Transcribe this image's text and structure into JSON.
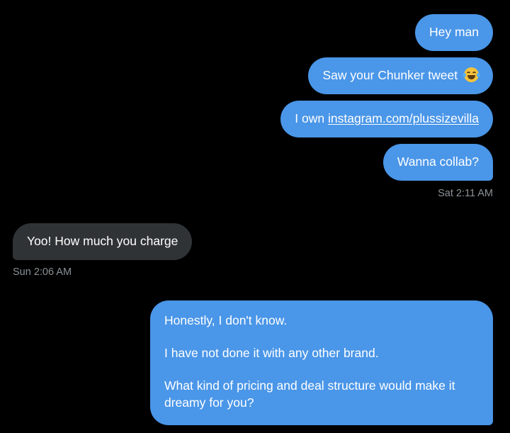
{
  "conversation": {
    "group_sat": {
      "messages": [
        {
          "text": "Hey man"
        },
        {
          "text": "Saw your Chunker tweet",
          "emoji": "face-with-tears-of-joy"
        },
        {
          "prefix": "I own ",
          "link": "instagram.com/plussizevilla"
        },
        {
          "text": "Wanna collab?"
        }
      ],
      "timestamp": "Sat 2:11 AM"
    },
    "group_sun": {
      "messages": [
        {
          "text": "Yoo! How much you charge"
        }
      ],
      "timestamp": "Sun 2:06 AM"
    },
    "group_reply": {
      "paragraphs": [
        "Honestly, I don't know.",
        "I have not done it with any other brand.",
        "What kind of pricing and deal structure would make it dreamy for you?"
      ]
    }
  },
  "colors": {
    "background": "#000000",
    "outgoing_bubble": "#4a96e8",
    "incoming_bubble": "#2f3336",
    "timestamp_text": "#8b9196"
  }
}
